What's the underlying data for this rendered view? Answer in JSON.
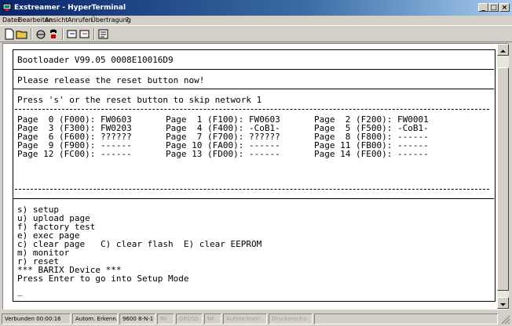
{
  "window": {
    "title": "Exstreamer - HyperTerminal",
    "controls": [
      "_",
      "□",
      "×"
    ]
  },
  "menu": [
    "Datei",
    "Bearbeiten",
    "Ansicht",
    "Anrufen",
    "Übertragung",
    "?"
  ],
  "toolbar": [
    "new-icon",
    "open-icon",
    "connect-icon",
    "disconnect-icon",
    "send-icon",
    "receive-icon",
    "properties-icon"
  ],
  "terminal": {
    "header": "Bootloader V99.05 0008E10016D9",
    "release_msg": "Please release the reset button now!",
    "skip_msg": "Press 's' or the reset button to skip network 1",
    "pages": [
      [
        "Page  0 (F000): FW0603",
        "Page  1 (F100): FW0603",
        "Page  2 (F200): FW0001"
      ],
      [
        "Page  3 (F300): FW0203",
        "Page  4 (F400): -CoB1-",
        "Page  5 (F500): -CoB1-"
      ],
      [
        "Page  6 (F600): ??????",
        "Page  7 (F700): ??????",
        "Page  8 (F800): ------"
      ],
      [
        "Page  9 (F900): ------",
        "Page 10 (FA00): ------",
        "Page 11 (FB00): ------"
      ],
      [
        "Page 12 (FC00): ------",
        "Page 13 (FD00): ------",
        "Page 14 (FE00): ------"
      ]
    ],
    "menu_lines": [
      "s) setup",
      "u) upload page",
      "f) factory test",
      "e) exec page",
      "c) clear page   C) clear flash  E) clear EEPROM",
      "m) monitor",
      "r) reset",
      "*** BARIX Device ***",
      "Press Enter to go into Setup Mode",
      "_"
    ]
  },
  "statusbar": {
    "connected": "Verbunden 00:00:16",
    "detect": "Autom. Erkenn.",
    "baud": "9600 8-N-1",
    "rf": "RF",
    "gross": "GROSS",
    "nf": "NF",
    "capture": "Aufzeichnen",
    "echo": "Druckerecho"
  }
}
